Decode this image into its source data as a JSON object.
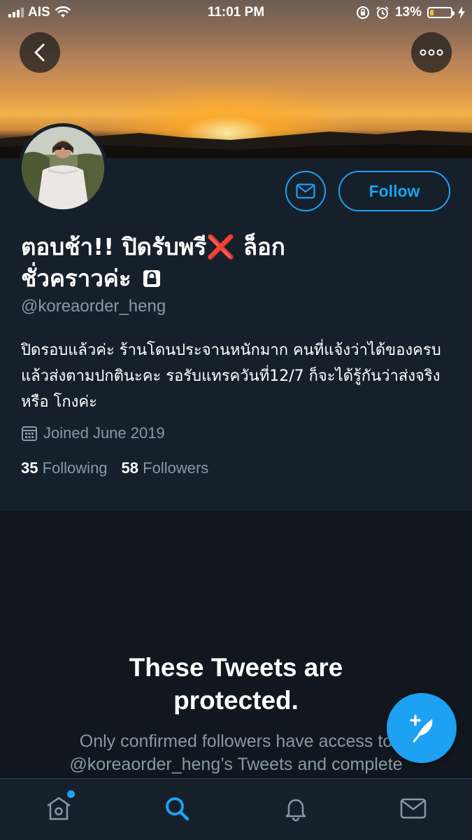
{
  "status_bar": {
    "carrier": "AIS",
    "time": "11:01 PM",
    "battery_percent": "13%"
  },
  "header": {
    "back_icon": "chevron-left-icon",
    "more_icon": "more-icon"
  },
  "profile": {
    "display_name_line1": "ตอบช้า!! ปิดรับพรี",
    "display_name_emoji": "❌",
    "display_name_line1_end": " ล็อก",
    "display_name_line2": "ชั่วคราวค่ะ",
    "lock_icon": "lock-icon",
    "handle": "@koreaorder_heng",
    "bio": "ปิดรอบแล้วค่ะ ร้านโดนประจานหนักมาก คนที่แจ้งว่าได้ของครบแล้วส่งตามปกตินะคะ รอรับแทรควันที่12/7 ก็จะได้รู้กันว่าส่งจริงหรือ โกงค่ะ",
    "joined": "Joined June 2019",
    "following_count": "35",
    "following_label": "Following",
    "followers_count": "58",
    "followers_label": "Followers"
  },
  "actions": {
    "message_icon": "mail-icon",
    "follow_label": "Follow"
  },
  "protected": {
    "title_line1": "These Tweets are",
    "title_line2": "protected.",
    "subtitle_line1": "Only confirmed followers have access to",
    "subtitle_line2": "@koreaorder_heng’s Tweets and complete"
  },
  "tabbar": {
    "items": [
      "home-icon",
      "search-icon",
      "notifications-icon",
      "messages-icon"
    ],
    "active": "search-icon"
  },
  "colors": {
    "accent": "#1da1f2",
    "background": "#15202b",
    "muted": "#8899a6"
  }
}
